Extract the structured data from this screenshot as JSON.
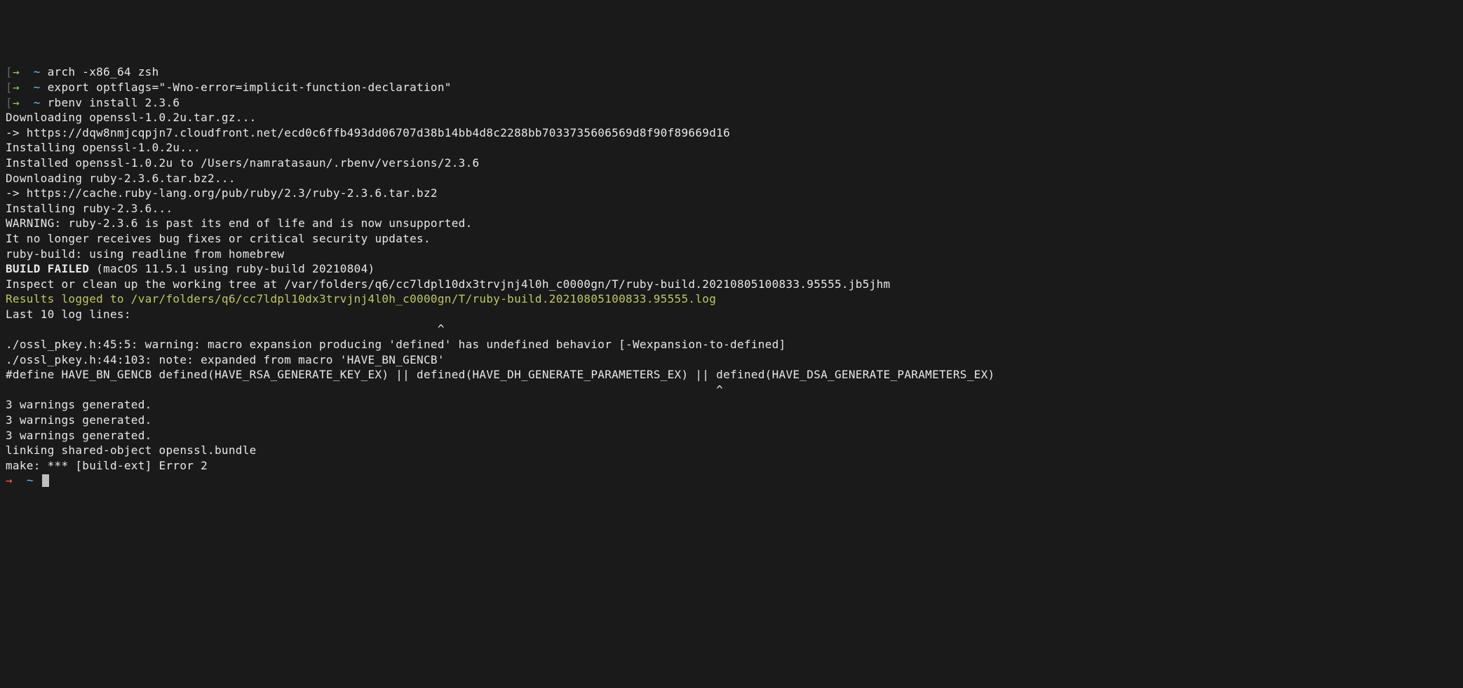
{
  "lines": {
    "l1_bracket_open": "[",
    "l1_arrow": "→",
    "l1_tilde": "~",
    "l1_cmd": "arch -x86_64 zsh",
    "l2_bracket_open": "[",
    "l2_arrow": "→",
    "l2_tilde": "~",
    "l2_cmd": "export optflags=\"-Wno-error=implicit-function-declaration\"",
    "l3_bracket_open": "[",
    "l3_arrow": "→",
    "l3_tilde": "~",
    "l3_cmd": "rbenv install 2.3.6",
    "l4": "Downloading openssl-1.0.2u.tar.gz...",
    "l5": "-> https://dqw8nmjcqpjn7.cloudfront.net/ecd0c6ffb493dd06707d38b14bb4d8c2288bb7033735606569d8f90f89669d16",
    "l6": "Installing openssl-1.0.2u...",
    "l7": "Installed openssl-1.0.2u to /Users/namratasaun/.rbenv/versions/2.3.6",
    "l8": "",
    "l9": "Downloading ruby-2.3.6.tar.bz2...",
    "l10": "-> https://cache.ruby-lang.org/pub/ruby/2.3/ruby-2.3.6.tar.bz2",
    "l11": "Installing ruby-2.3.6...",
    "l12": "",
    "l13": "WARNING: ruby-2.3.6 is past its end of life and is now unsupported.",
    "l14": "It no longer receives bug fixes or critical security updates.",
    "l15": "",
    "l16": "ruby-build: using readline from homebrew",
    "l17": "",
    "l18_bold": "BUILD FAILED",
    "l18_rest": " (macOS 11.5.1 using ruby-build 20210804)",
    "l19": "",
    "l20": "Inspect or clean up the working tree at /var/folders/q6/cc7ldpl10dx3trvjnj4l0h_c0000gn/T/ruby-build.20210805100833.95555.jb5jhm",
    "l21": "Results logged to /var/folders/q6/cc7ldpl10dx3trvjnj4l0h_c0000gn/T/ruby-build.20210805100833.95555.log",
    "l22": "",
    "l23": "Last 10 log lines:",
    "l24": "                                                              ^",
    "l25": "./ossl_pkey.h:45:5: warning: macro expansion producing 'defined' has undefined behavior [-Wexpansion-to-defined]",
    "l26": "./ossl_pkey.h:44:103: note: expanded from macro 'HAVE_BN_GENCB'",
    "l27": "#define HAVE_BN_GENCB defined(HAVE_RSA_GENERATE_KEY_EX) || defined(HAVE_DH_GENERATE_PARAMETERS_EX) || defined(HAVE_DSA_GENERATE_PARAMETERS_EX)",
    "l28": "                                                                                                      ^",
    "l29": "3 warnings generated.",
    "l30": "3 warnings generated.",
    "l31": "3 warnings generated.",
    "l32": "linking shared-object openssl.bundle",
    "l33": "make: *** [build-ext] Error 2",
    "l34_arrow": "→",
    "l34_tilde": "~"
  }
}
